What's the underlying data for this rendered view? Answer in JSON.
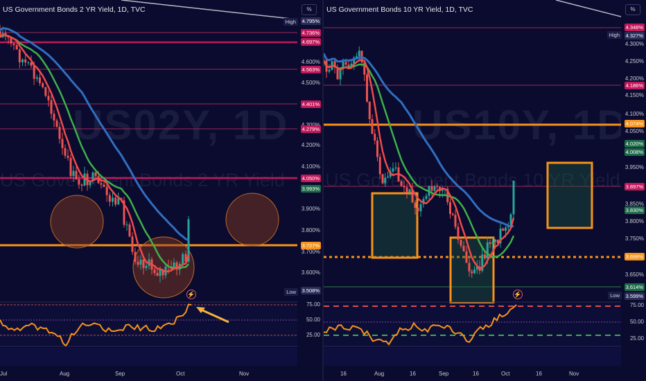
{
  "left": {
    "title": "US Government Bonds 2 YR Yield, 1D, TVC",
    "watermark": "US02Y, 1D",
    "watermark_sub": "US Government Bonds 2 YR Yield",
    "pct_button": "%",
    "ticks": [
      "4.600%",
      "4.500%",
      "4.300%",
      "4.200%",
      "4.100%",
      "3.900%",
      "3.800%",
      "3.700%",
      "3.600%"
    ],
    "tags": [
      {
        "label": "4.795%",
        "color": "#2a2c58"
      },
      {
        "label": "4.736%",
        "color": "#c2185b"
      },
      {
        "label": "4.697%",
        "color": "#c2185b"
      },
      {
        "label": "4.563%",
        "color": "#c2185b"
      },
      {
        "label": "4.401%",
        "color": "#c2185b"
      },
      {
        "label": "4.279%",
        "color": "#c2185b"
      },
      {
        "label": "4.050%",
        "color": "#c2185b"
      },
      {
        "label": "3.993%",
        "color": "#1e6b4a"
      },
      {
        "label": "3.727%",
        "color": "#f7931a"
      },
      {
        "label": "3.508%",
        "color": "#2a2c58"
      }
    ],
    "high_label": "High",
    "low_label": "Low",
    "rsi_ticks": [
      "75.00",
      "50.00",
      "25.00"
    ],
    "x_labels": [
      "Jul",
      "Aug",
      "Sep",
      "Oct",
      "Nov"
    ]
  },
  "right": {
    "title": "US Government Bonds 10 YR Yield, 1D, TVC",
    "watermark": "US10Y, 1D",
    "watermark_sub": "US Government Bonds 10 YR Yield",
    "pct_button": "%",
    "ticks": [
      "4.300%",
      "4.250%",
      "4.200%",
      "4.150%",
      "4.100%",
      "4.050%",
      "3.950%",
      "3.900%",
      "3.850%",
      "3.800%",
      "3.750%",
      "3.650%"
    ],
    "tags": [
      {
        "label": "4.348%",
        "color": "#c2185b"
      },
      {
        "label": "4.327%",
        "color": "#2a2c58"
      },
      {
        "label": "4.186%",
        "color": "#c2185b"
      },
      {
        "label": "4.074%",
        "color": "#f7931a"
      },
      {
        "label": "4.020%",
        "color": "#1e6b4a"
      },
      {
        "label": "4.008%",
        "color": "#1e6b4a"
      },
      {
        "label": "3.897%",
        "color": "#c2185b"
      },
      {
        "label": "3.830%",
        "color": "#1e6b4a"
      },
      {
        "label": "3.699%",
        "color": "#f7931a"
      },
      {
        "label": "3.614%",
        "color": "#1e6b4a"
      },
      {
        "label": "3.599%",
        "color": "#2a2c58"
      }
    ],
    "high_label": "High",
    "low_label": "Low",
    "rsi_ticks": [
      "75.00",
      "50.00",
      "25.00"
    ],
    "x_labels": [
      "16",
      "Aug",
      "16",
      "Sep",
      "16",
      "Oct",
      "16",
      "Nov"
    ]
  }
}
